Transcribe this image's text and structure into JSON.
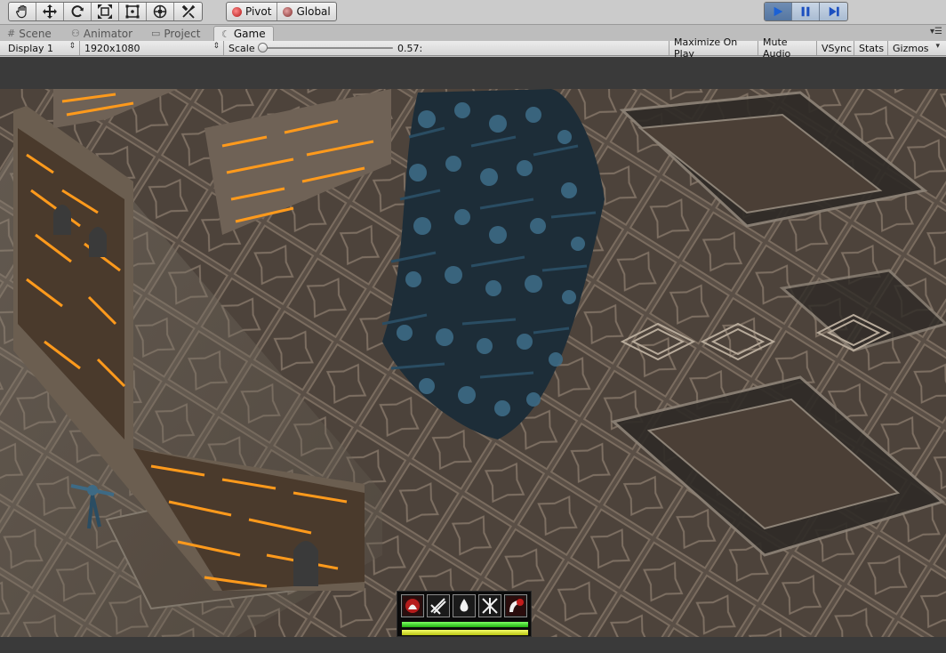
{
  "toolbar": {
    "transform_tools": [
      {
        "name": "hand-tool-icon"
      },
      {
        "name": "move-tool-icon"
      },
      {
        "name": "rotate-tool-icon"
      },
      {
        "name": "scale-tool-icon"
      },
      {
        "name": "rect-tool-icon"
      },
      {
        "name": "transform-tool-icon"
      },
      {
        "name": "custom-tool-icon"
      }
    ],
    "pivot_label": "Pivot",
    "global_label": "Global",
    "play_controls": [
      "play",
      "pause",
      "step"
    ]
  },
  "tabs": [
    {
      "label": "Scene",
      "icon": "#"
    },
    {
      "label": "Animator",
      "icon": "⚇"
    },
    {
      "label": "Project",
      "icon": "▭"
    },
    {
      "label": "Game",
      "icon": "☾",
      "active": true
    }
  ],
  "game_bar": {
    "display": "Display 1",
    "resolution": "1920x1080",
    "scale_label": "Scale",
    "scale_value": "0.57:",
    "scale_fraction": 0.01,
    "maximize_on_play": "Maximize On Play",
    "mute_audio": "Mute Audio",
    "vsync": "VSync",
    "stats": "Stats",
    "gizmos": "Gizmos"
  },
  "hud": {
    "skills": [
      "fire-skill-icon",
      "slash-skill-icon",
      "drop-skill-icon",
      "cross-slash-skill-icon",
      "horn-skill-icon"
    ],
    "health_fraction": 1.0,
    "mana_fraction": 1.0
  },
  "colors": {
    "accent_play": "#5576a1",
    "health": "#2ecc1e",
    "mana": "#d8e623",
    "lava": "#ff9a1c"
  }
}
